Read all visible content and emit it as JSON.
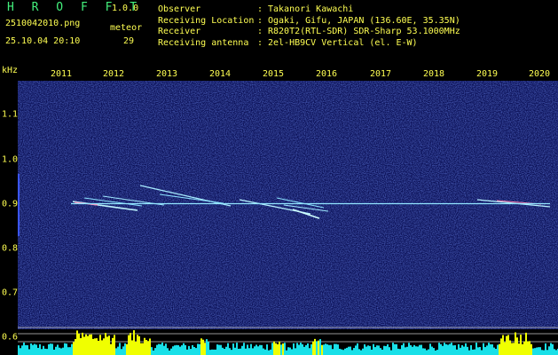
{
  "app": {
    "title": "H R O F F T",
    "version": "1.0.0"
  },
  "file": {
    "name": "2510042010.png",
    "datetime": "25.10.04 20:10"
  },
  "meteor": {
    "label": "meteor",
    "count": "29"
  },
  "info": {
    "rows": [
      {
        "key": "Observer",
        "value": "Takanori Kawachi"
      },
      {
        "key": "Receiving Location",
        "value": "Ogaki, Gifu, JAPAN (136.60E, 35.35N)"
      },
      {
        "key": "Receiver",
        "value": "R820T2(RTL-SDR) SDR-Sharp 53.1000MHz"
      },
      {
        "key": "Receiving antenna",
        "value": "2el-HB9CV Vertical (el. E-W)"
      }
    ],
    "colon": ":"
  },
  "axis": {
    "unit": "kHz",
    "years": [
      "2011",
      "2012",
      "2013",
      "2014",
      "2015",
      "2016",
      "2017",
      "2018",
      "2019",
      "2020"
    ],
    "yticks": [
      "1.1",
      "1.0",
      "0.9",
      "0.8",
      "0.7",
      "0.6"
    ]
  },
  "colors": {
    "text_yellow": "#ffff52",
    "title_green": "#43f07c",
    "carrier": "#5fd6ff",
    "histogram_yellow": "#f0ff00",
    "histogram_cyan": "#19e0e8"
  }
}
